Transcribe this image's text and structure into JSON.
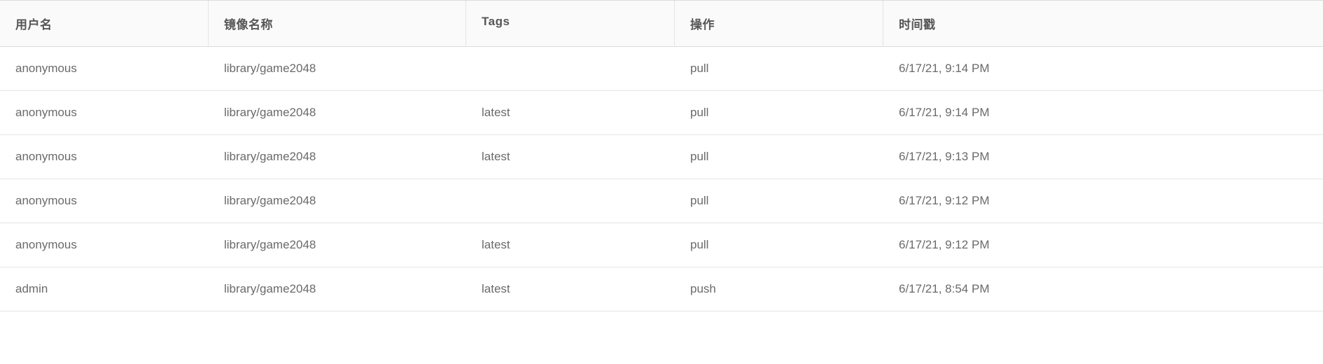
{
  "table": {
    "headers": {
      "user": "用户名",
      "image": "镜像名称",
      "tags": "Tags",
      "operation": "操作",
      "timestamp": "时间戳"
    },
    "rows": [
      {
        "user": "anonymous",
        "image": "library/game2048",
        "tags": "",
        "operation": "pull",
        "timestamp": "6/17/21, 9:14 PM"
      },
      {
        "user": "anonymous",
        "image": "library/game2048",
        "tags": "latest",
        "operation": "pull",
        "timestamp": "6/17/21, 9:14 PM"
      },
      {
        "user": "anonymous",
        "image": "library/game2048",
        "tags": "latest",
        "operation": "pull",
        "timestamp": "6/17/21, 9:13 PM"
      },
      {
        "user": "anonymous",
        "image": "library/game2048",
        "tags": "",
        "operation": "pull",
        "timestamp": "6/17/21, 9:12 PM"
      },
      {
        "user": "anonymous",
        "image": "library/game2048",
        "tags": "latest",
        "operation": "pull",
        "timestamp": "6/17/21, 9:12 PM"
      },
      {
        "user": "admin",
        "image": "library/game2048",
        "tags": "latest",
        "operation": "push",
        "timestamp": "6/17/21, 8:54 PM"
      }
    ]
  }
}
